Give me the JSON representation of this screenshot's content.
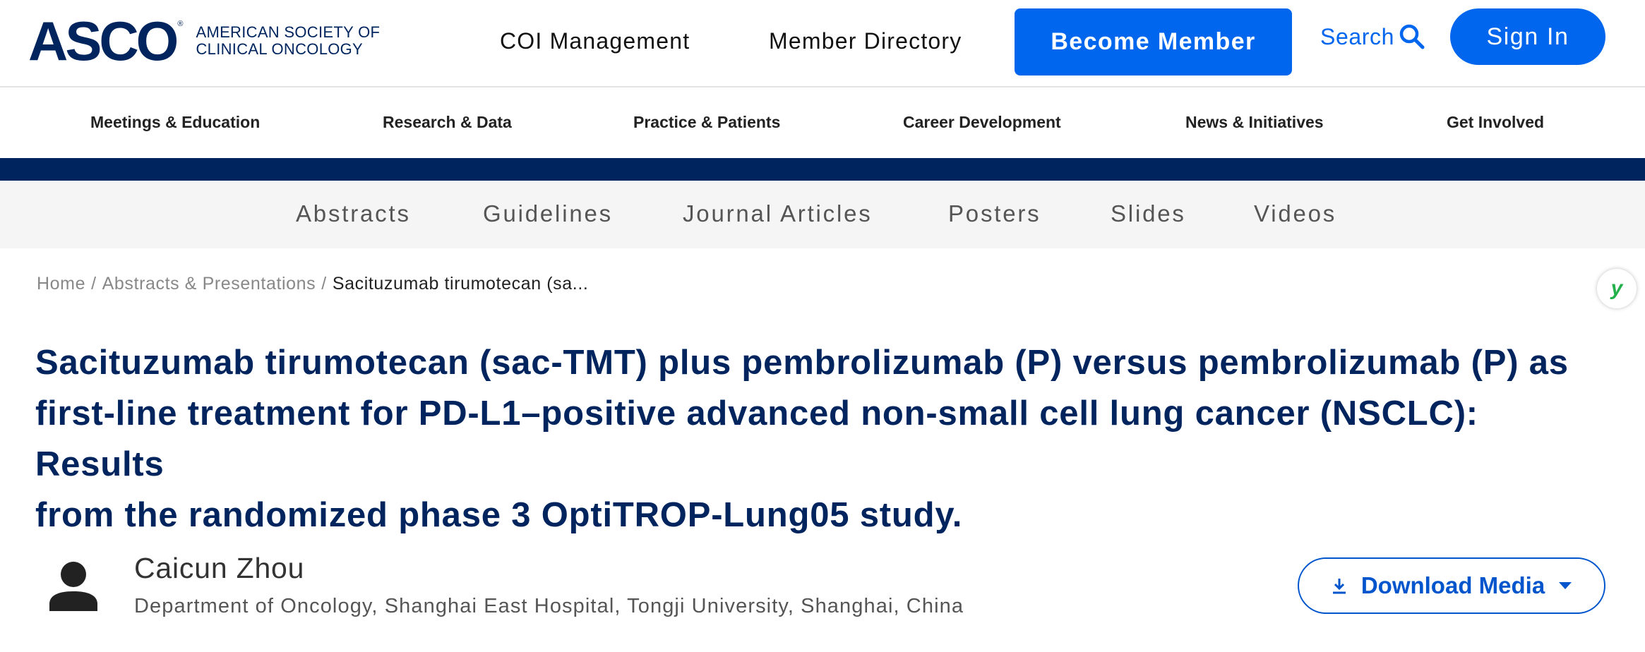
{
  "header": {
    "logo_mark": "ASCO",
    "logo_reg": "®",
    "logo_line1": "AMERICAN SOCIETY OF",
    "logo_line2": "CLINICAL ONCOLOGY",
    "links": [
      "COI Management",
      "Member Directory"
    ],
    "become_member": "Become Member",
    "search": "Search",
    "sign_in": "Sign In"
  },
  "main_nav": [
    "Meetings & Education",
    "Research & Data",
    "Practice & Patients",
    "Career Development",
    "News & Initiatives",
    "Get Involved"
  ],
  "sub_nav": [
    "Abstracts",
    "Guidelines",
    "Journal Articles",
    "Posters",
    "Slides",
    "Videos"
  ],
  "breadcrumb": {
    "home": "Home",
    "section": "Abstracts & Presentations",
    "current": "Sacituzumab tirumotecan (sa...",
    "separator": "/"
  },
  "badge": {
    "icon": "y-logo-icon",
    "text": "y"
  },
  "title_lines": [
    "Sacituzumab tirumotecan (sac-TMT) plus pembrolizumab (P) versus pembrolizumab (P) as",
    "first-line treatment for PD-L1–positive advanced non-small cell lung cancer (NSCLC): Results",
    "from the randomized phase 3 OptiTROP-Lung05 study."
  ],
  "author": {
    "name": "Caicun Zhou",
    "affiliation": "Department of Oncology, Shanghai East Hospital, Tongji University, Shanghai, China"
  },
  "download_media": "Download Media",
  "colors": {
    "brand_navy": "#00245d",
    "primary_blue": "#0066ee",
    "badge_green": "#22b04b"
  }
}
